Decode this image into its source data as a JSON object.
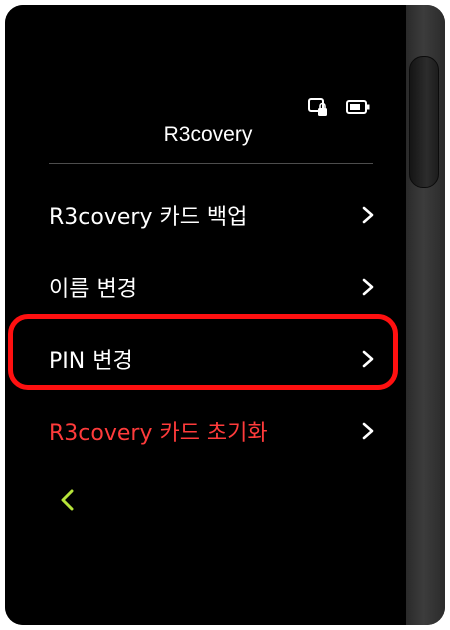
{
  "header": {
    "title": "R3covery",
    "status_icons": [
      "card-lock-icon",
      "battery-icon"
    ]
  },
  "menu": {
    "items": [
      {
        "label": "R3covery 카드 백업",
        "style": "normal"
      },
      {
        "label": "이름 변경",
        "style": "normal"
      },
      {
        "label": "PIN 변경",
        "style": "highlighted"
      },
      {
        "label": "R3covery 카드 초기화",
        "style": "danger"
      }
    ]
  },
  "colors": {
    "danger": "#ff3b3b",
    "highlight": "#ff1010",
    "back_accent": "#b6e43a"
  },
  "footer": {
    "back_icon": "chevron-left-icon"
  }
}
